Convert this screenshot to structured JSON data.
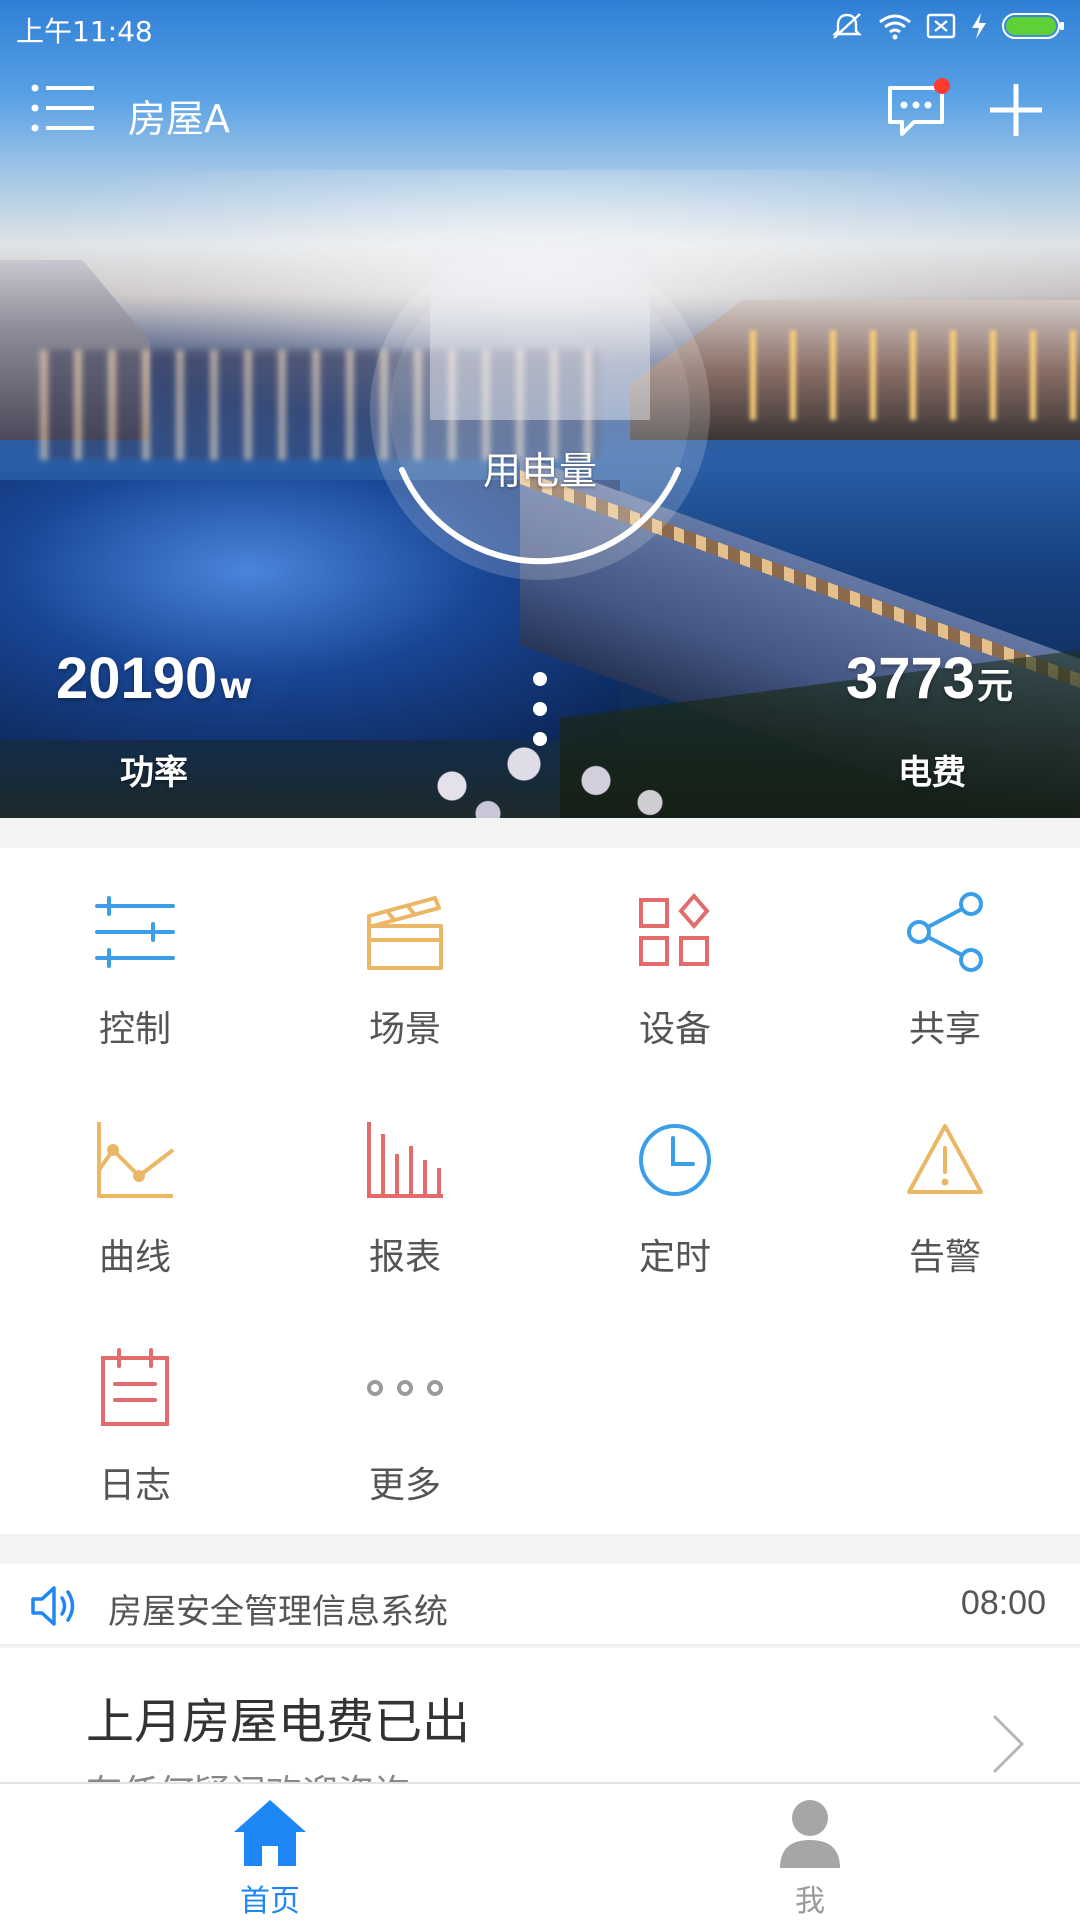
{
  "status_bar": {
    "time": "上午11:48"
  },
  "header": {
    "title": "房屋A",
    "menu_icon": "menu-icon",
    "message_icon": "message-icon",
    "add_icon": "add-icon"
  },
  "hero": {
    "gauge_label": "用电量",
    "power": {
      "value": "20190",
      "unit": "w",
      "label": "功率"
    },
    "fee": {
      "value": "3773",
      "unit": "元",
      "label": "电费"
    }
  },
  "grid": {
    "items": [
      {
        "label": "控制",
        "icon": "control-icon",
        "color": "#3a9fe8"
      },
      {
        "label": "场景",
        "icon": "scene-icon",
        "color": "#eab766"
      },
      {
        "label": "设备",
        "icon": "device-icon",
        "color": "#e36b6b"
      },
      {
        "label": "共享",
        "icon": "share-icon",
        "color": "#3a9fe8"
      },
      {
        "label": "曲线",
        "icon": "curve-icon",
        "color": "#eab766"
      },
      {
        "label": "报表",
        "icon": "report-icon",
        "color": "#e36b6b"
      },
      {
        "label": "定时",
        "icon": "timer-icon",
        "color": "#3a9fe8"
      },
      {
        "label": "告警",
        "icon": "alarm-icon",
        "color": "#eab766"
      },
      {
        "label": "日志",
        "icon": "log-icon",
        "color": "#e36b6b"
      },
      {
        "label": "更多",
        "icon": "more-icon",
        "color": "#9a9a9a"
      }
    ]
  },
  "notice": {
    "text": "房屋安全管理信息系统",
    "time": "08:00"
  },
  "news": {
    "title": "上月房屋电费已出",
    "subtitle": "有任何疑问欢迎咨询"
  },
  "tabbar": {
    "home_label": "首页",
    "me_label": "我"
  },
  "colors": {
    "accent": "#1f87f5",
    "notification_dot": "#ff3b30"
  }
}
